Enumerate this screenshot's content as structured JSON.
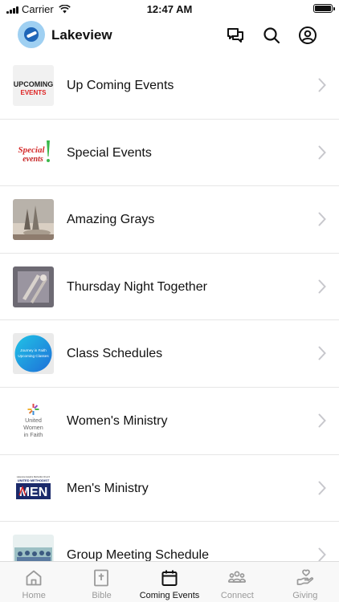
{
  "status_bar": {
    "carrier": "Carrier",
    "time": "12:47 AM"
  },
  "header": {
    "title": "Lakeview"
  },
  "events": [
    {
      "label": "Up Coming Events",
      "thumb_text": [
        "UPCOMING",
        "EVENTS"
      ]
    },
    {
      "label": "Special Events",
      "thumb_text": [
        "Special",
        "events"
      ]
    },
    {
      "label": "Amazing Grays"
    },
    {
      "label": "Thursday Night Together"
    },
    {
      "label": "Class Schedules",
      "thumb_text": [
        "Journey in Faith",
        "Upcoming Classes"
      ]
    },
    {
      "label": "Women's Ministry",
      "thumb_text": [
        "United",
        "Women",
        "in Faith"
      ]
    },
    {
      "label": "Men's Ministry",
      "thumb_text": [
        "Lakeview Heights Methodist Church",
        "UNITED METHODIST",
        "MEN"
      ]
    },
    {
      "label": "Group Meeting Schedule"
    }
  ],
  "tabs": [
    {
      "label": "Home",
      "active": false
    },
    {
      "label": "Bible",
      "active": false
    },
    {
      "label": "Coming Events",
      "active": true
    },
    {
      "label": "Connect",
      "active": false
    },
    {
      "label": "Giving",
      "active": false
    }
  ],
  "colors": {
    "active_tab": "#111111",
    "inactive_tab": "#9a9a9a",
    "brand_logo": "#1f66b8"
  }
}
